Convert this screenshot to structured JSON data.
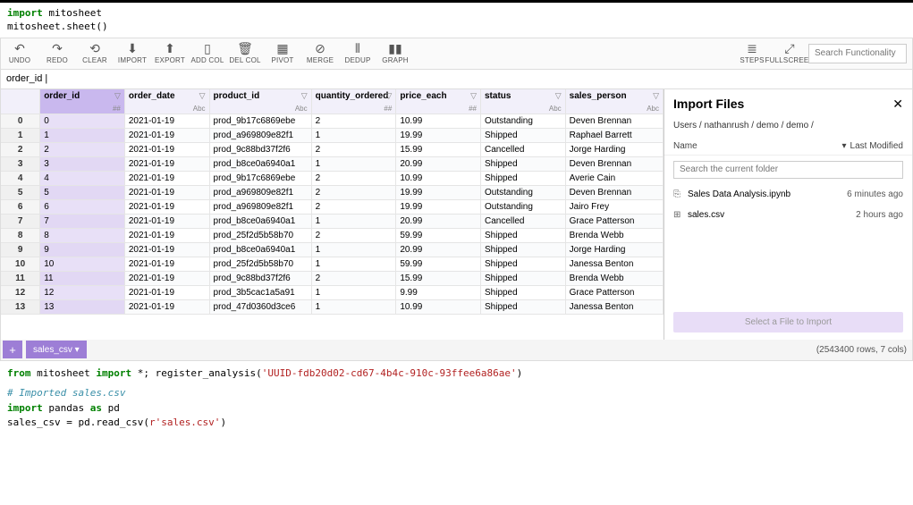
{
  "code_top": {
    "line1_kw": "import",
    "line1_rest": " mitosheet",
    "line2": "mitosheet.sheet()"
  },
  "toolbar": {
    "undo": "UNDO",
    "redo": "REDO",
    "clear": "CLEAR",
    "import": "IMPORT",
    "export": "EXPORT",
    "addcol": "ADD COL",
    "delcol": "DEL COL",
    "pivot": "PIVOT",
    "merge": "MERGE",
    "dedup": "DEDUP",
    "graph": "GRAPH",
    "steps": "STEPS",
    "fullscreen": "FULLSCREEN",
    "search_placeholder": "Search Functionality"
  },
  "formula_bar": {
    "value": "order_id |"
  },
  "columns": [
    {
      "name": "order_id",
      "dtype": "##",
      "selected": true
    },
    {
      "name": "order_date",
      "dtype": "Abc"
    },
    {
      "name": "product_id",
      "dtype": "Abc"
    },
    {
      "name": "quantity_ordered",
      "dtype": "##"
    },
    {
      "name": "price_each",
      "dtype": "##"
    },
    {
      "name": "status",
      "dtype": "Abc"
    },
    {
      "name": "sales_person",
      "dtype": "Abc"
    }
  ],
  "rows": [
    {
      "idx": "0",
      "order_id": "0",
      "order_date": "2021-01-19",
      "product_id": "prod_9b17c6869ebe",
      "quantity": "2",
      "price": "10.99",
      "status": "Outstanding",
      "person": "Deven Brennan"
    },
    {
      "idx": "1",
      "order_id": "1",
      "order_date": "2021-01-19",
      "product_id": "prod_a969809e82f1",
      "quantity": "1",
      "price": "19.99",
      "status": "Shipped",
      "person": "Raphael Barrett"
    },
    {
      "idx": "2",
      "order_id": "2",
      "order_date": "2021-01-19",
      "product_id": "prod_9c88bd37f2f6",
      "quantity": "2",
      "price": "15.99",
      "status": "Cancelled",
      "person": "Jorge Harding"
    },
    {
      "idx": "3",
      "order_id": "3",
      "order_date": "2021-01-19",
      "product_id": "prod_b8ce0a6940a1",
      "quantity": "1",
      "price": "20.99",
      "status": "Shipped",
      "person": "Deven Brennan"
    },
    {
      "idx": "4",
      "order_id": "4",
      "order_date": "2021-01-19",
      "product_id": "prod_9b17c6869ebe",
      "quantity": "2",
      "price": "10.99",
      "status": "Shipped",
      "person": "Averie Cain"
    },
    {
      "idx": "5",
      "order_id": "5",
      "order_date": "2021-01-19",
      "product_id": "prod_a969809e82f1",
      "quantity": "2",
      "price": "19.99",
      "status": "Outstanding",
      "person": "Deven Brennan"
    },
    {
      "idx": "6",
      "order_id": "6",
      "order_date": "2021-01-19",
      "product_id": "prod_a969809e82f1",
      "quantity": "2",
      "price": "19.99",
      "status": "Outstanding",
      "person": "Jairo Frey"
    },
    {
      "idx": "7",
      "order_id": "7",
      "order_date": "2021-01-19",
      "product_id": "prod_b8ce0a6940a1",
      "quantity": "1",
      "price": "20.99",
      "status": "Cancelled",
      "person": "Grace Patterson"
    },
    {
      "idx": "8",
      "order_id": "8",
      "order_date": "2021-01-19",
      "product_id": "prod_25f2d5b58b70",
      "quantity": "2",
      "price": "59.99",
      "status": "Shipped",
      "person": "Brenda Webb"
    },
    {
      "idx": "9",
      "order_id": "9",
      "order_date": "2021-01-19",
      "product_id": "prod_b8ce0a6940a1",
      "quantity": "1",
      "price": "20.99",
      "status": "Shipped",
      "person": "Jorge Harding"
    },
    {
      "idx": "10",
      "order_id": "10",
      "order_date": "2021-01-19",
      "product_id": "prod_25f2d5b58b70",
      "quantity": "1",
      "price": "59.99",
      "status": "Shipped",
      "person": "Janessa Benton"
    },
    {
      "idx": "11",
      "order_id": "11",
      "order_date": "2021-01-19",
      "product_id": "prod_9c88bd37f2f6",
      "quantity": "2",
      "price": "15.99",
      "status": "Shipped",
      "person": "Brenda Webb"
    },
    {
      "idx": "12",
      "order_id": "12",
      "order_date": "2021-01-19",
      "product_id": "prod_3b5cac1a5a91",
      "quantity": "1",
      "price": "9.99",
      "status": "Shipped",
      "person": "Grace Patterson"
    },
    {
      "idx": "13",
      "order_id": "13",
      "order_date": "2021-01-19",
      "product_id": "prod_47d0360d3ce6",
      "quantity": "1",
      "price": "10.99",
      "status": "Shipped",
      "person": "Janessa Benton"
    }
  ],
  "side": {
    "title": "Import Files",
    "breadcrumb": "Users / nathanrush / demo / demo /",
    "name_col": "Name",
    "mod_col": "Last Modified",
    "sort_arrow": "▾",
    "search_placeholder": "Search the current folder",
    "files": [
      {
        "icon": "⎘",
        "name": "Sales Data Analysis.ipynb",
        "mod": "6 minutes ago"
      },
      {
        "icon": "⊞",
        "name": "sales.csv",
        "mod": "2 hours ago"
      }
    ],
    "import_label": "Select a File to Import"
  },
  "tabs": {
    "add": "+",
    "tab0": "sales_csv ▾",
    "rowcount": "(2543400 rows, 7 cols)"
  },
  "code_bottom": {
    "l1a": "from ",
    "l1b": "mitosheet ",
    "l1c": "import ",
    "l1d": "*; register_analysis(",
    "l1e": "'UUID-fdb20d02-cd67-4b4c-910c-93ffee6a86ae'",
    "l1f": ")",
    "l2": "# Imported sales.csv",
    "l3a": "import ",
    "l3b": "pandas ",
    "l3c": "as ",
    "l3d": "pd",
    "l4a": "sales_csv = pd.read_csv(",
    "l4b": "r'sales.csv'",
    "l4c": ")"
  }
}
